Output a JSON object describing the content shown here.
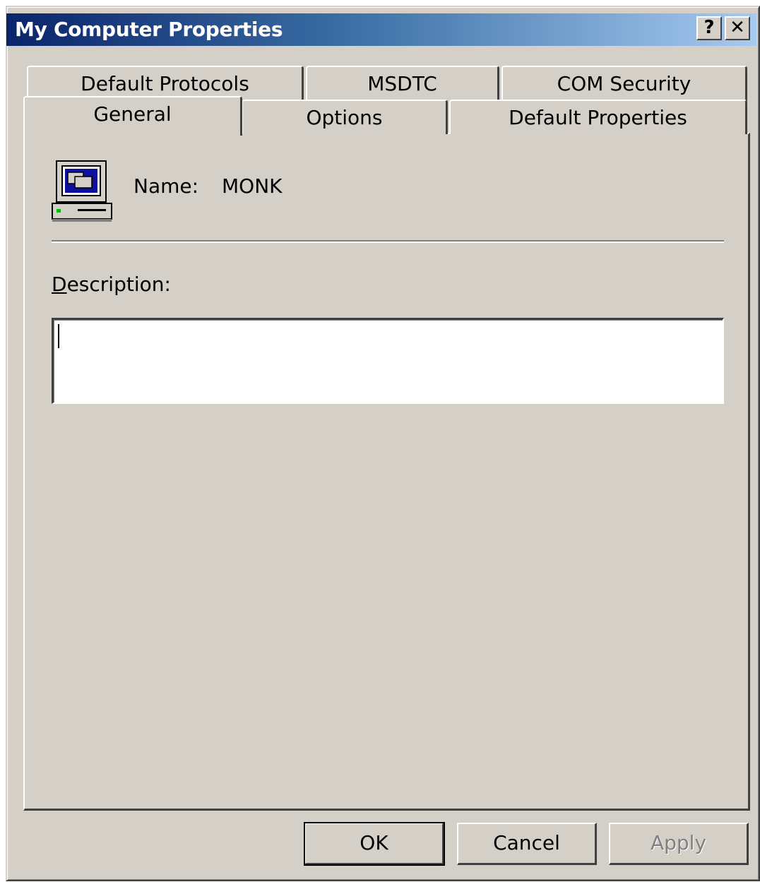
{
  "window": {
    "title": "My Computer Properties",
    "help_label": "?",
    "close_label": "✕"
  },
  "tabs_back": [
    {
      "label": "Default Protocols"
    },
    {
      "label": "MSDTC"
    },
    {
      "label": "COM Security"
    }
  ],
  "tabs_front": [
    {
      "label": "General",
      "selected": true
    },
    {
      "label": "Options"
    },
    {
      "label": "Default Properties"
    }
  ],
  "general": {
    "name_label": "Name:",
    "name_value": "MONK",
    "description_label_mnemonic": "D",
    "description_label_rest": "escription:",
    "description_value": ""
  },
  "buttons": {
    "ok": "OK",
    "cancel": "Cancel",
    "apply": "Apply"
  },
  "icons": {
    "computer": "computer-icon"
  }
}
